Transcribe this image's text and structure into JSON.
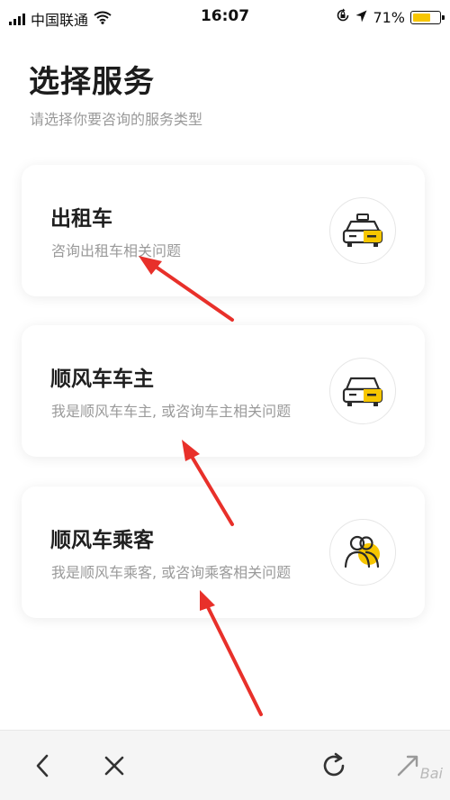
{
  "status_bar": {
    "carrier": "中国联通",
    "time": "16:07",
    "battery_percent": "71%",
    "battery_level": 0.71,
    "icons": [
      "signal-icon",
      "wifi-icon",
      "orientation-lock-icon",
      "location-icon",
      "battery-icon"
    ]
  },
  "header": {
    "title": "选择服务",
    "subtitle": "请选择你要咨询的服务类型"
  },
  "services": [
    {
      "title": "出租车",
      "description": "咨询出租车相关问题",
      "icon": "taxi-icon"
    },
    {
      "title": "顺风车车主",
      "description": "我是顺风车车主, 或咨询车主相关问题",
      "icon": "car-icon"
    },
    {
      "title": "顺风车乘客",
      "description": "我是顺风车乘客, 或咨询乘客相关问题",
      "icon": "passengers-icon"
    }
  ],
  "bottom_bar": {
    "icons": [
      "back-icon",
      "close-icon",
      "refresh-icon",
      "expand-icon"
    ],
    "watermark": "Bai"
  },
  "colors": {
    "accent": "#f7c600",
    "annotation_arrow": "#e8302a",
    "text_primary": "#1f1f1f",
    "text_secondary": "#9a9a9a"
  }
}
